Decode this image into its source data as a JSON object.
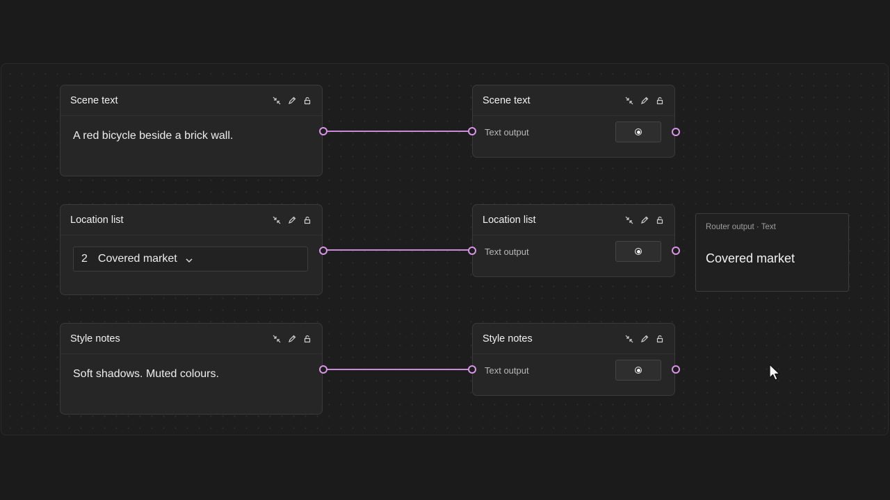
{
  "input_nodes": [
    {
      "title": "Scene text",
      "content": "A red bicycle beside a brick wall."
    },
    {
      "title": "Location list",
      "select_index": "2",
      "select_value": "Covered market"
    },
    {
      "title": "Style notes",
      "content": "Soft shadows. Muted colours."
    }
  ],
  "output_nodes": [
    {
      "title": "Scene text",
      "output_label": "Text output"
    },
    {
      "title": "Location list",
      "output_label": "Text output"
    },
    {
      "title": "Style notes",
      "output_label": "Text output"
    }
  ],
  "header_icons": [
    "collapse-icon",
    "pencil-icon",
    "lock-icon"
  ],
  "router": {
    "label": "Router output · Text",
    "value": "Covered market"
  },
  "colors": {
    "background": "#1b1b1b",
    "node": "#262626",
    "wire": "#c98ad8",
    "port": "#d995e6",
    "text": "#ececec"
  }
}
